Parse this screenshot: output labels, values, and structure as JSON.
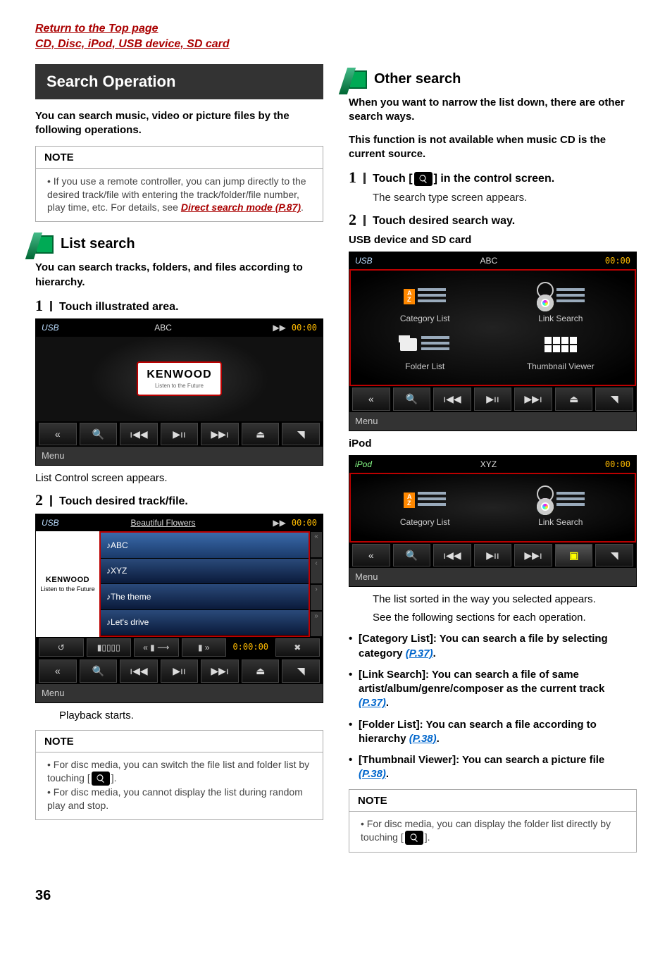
{
  "top": {
    "return": "Return to the Top page",
    "breadcrumb": "CD, Disc, iPod, USB device, SD card"
  },
  "left": {
    "section_title": "Search Operation",
    "intro": "You can search music, video or picture files by the following operations.",
    "note1": {
      "title": "NOTE",
      "item": "If you use a remote controller, you can jump directly to the desired track/file with entering the track/folder/file number, play time, etc. For details, see ",
      "link": "Direct search mode (P.87)",
      "after": "."
    },
    "list_search": {
      "heading": "List search",
      "intro": "You can search tracks, folders, and files according to hierarchy.",
      "step1": "Touch illustrated area.",
      "ss1": {
        "src": "USB",
        "title": "ABC",
        "time": "00:00",
        "kenwood": "KENWOOD",
        "sub": "Listen to the Future",
        "menu": "Menu"
      },
      "after1": "List Control screen appears.",
      "step2": "Touch desired track/file.",
      "ss2": {
        "src": "USB",
        "title": "Beautiful Flowers",
        "time": "00:00",
        "art_big": "KENWOOD",
        "art_small": "Listen to the Future",
        "rows": [
          "ABC",
          "XYZ",
          "The theme",
          "Let's drive"
        ],
        "elapsed": "0:00:00",
        "menu": "Menu"
      },
      "after2": "Playback starts.",
      "note2": {
        "title": "NOTE",
        "item1a": "For disc media, you can switch the file list and folder list by touching [",
        "item1b": "].",
        "item2": "For disc media, you cannot display the list during random play and stop."
      }
    }
  },
  "right": {
    "heading": "Other search",
    "intro1": "When you want to narrow the list down, there are other search ways.",
    "intro2": "This function is not available when music CD is the current source.",
    "step1a": "Touch [",
    "step1b": "] in the control screen.",
    "step1_sub": "The search type screen appears.",
    "step2": "Touch desired search way.",
    "caption1": "USB device and SD card",
    "ss3": {
      "src": "USB",
      "title": "ABC",
      "time": "00:00",
      "tiles": [
        "Category List",
        "Link Search",
        "Folder List",
        "Thumbnail Viewer"
      ],
      "menu": "Menu"
    },
    "caption2": "iPod",
    "ss4": {
      "src": "iPod",
      "title": "XYZ",
      "time": "00:00",
      "tiles": [
        "Category List",
        "Link Search"
      ],
      "menu": "Menu"
    },
    "result1": "The list sorted in the way you selected appears.",
    "result2": "See the following sections for each operation.",
    "bullets": [
      {
        "pre": "[Category List]: You can search a file by selecting category ",
        "link": "(P.37)",
        "post": "."
      },
      {
        "pre": "[Link Search]: You can search a file of same artist/album/genre/composer as the current track ",
        "link": "(P.37)",
        "post": "."
      },
      {
        "pre": "[Folder List]: You can search a file according to hierarchy ",
        "link": "(P.38)",
        "post": "."
      },
      {
        "pre": "[Thumbnail Viewer]: You can search a picture file ",
        "link": "(P.38)",
        "post": "."
      }
    ],
    "note": {
      "title": "NOTE",
      "item_a": "For disc media, you can display the folder list directly by touching [",
      "item_b": "]."
    }
  },
  "page": "36"
}
